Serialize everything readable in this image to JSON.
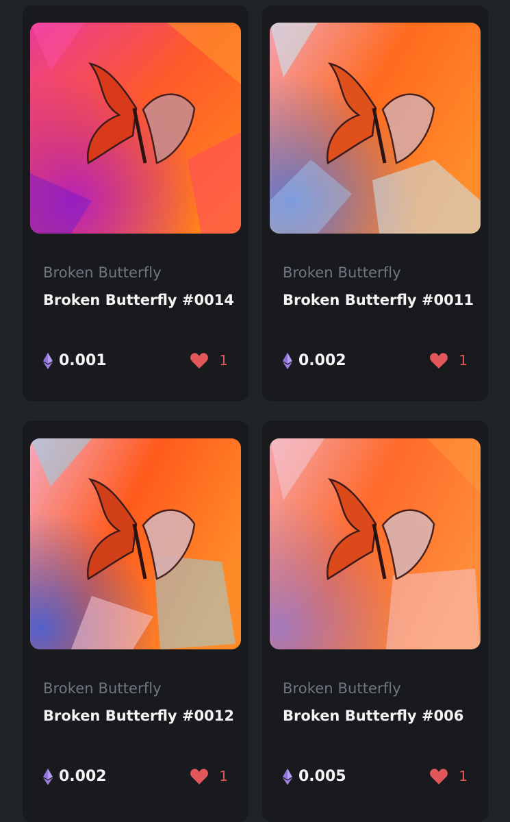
{
  "colors": {
    "page_bg": "#1f2428",
    "card_bg": "#181a1d",
    "collection_text": "#6f7882",
    "title_text": "#f4f4f4",
    "like_red": "#e2585a",
    "eth_purple": "#9b7de0"
  },
  "cards": [
    {
      "collection": "Broken Butterfly",
      "title": "Broken Butterfly #0014",
      "price": "0.001",
      "likes": "1",
      "currency_icon": "ethereum-icon",
      "like_icon": "heart-icon",
      "image_palette": [
        "#e83a9a",
        "#ff5a2a",
        "#b11ec0",
        "#ff8a1a",
        "#ff3f6e"
      ]
    },
    {
      "collection": "Broken Butterfly",
      "title": "Broken Butterfly #0011",
      "price": "0.002",
      "likes": "1",
      "currency_icon": "ethereum-icon",
      "like_icon": "heart-icon",
      "image_palette": [
        "#f2a3b5",
        "#ff6a1e",
        "#5a7ad8",
        "#ff8c2a",
        "#c9e6f2"
      ]
    },
    {
      "collection": "Broken Butterfly",
      "title": "Broken Butterfly #0012",
      "price": "0.002",
      "likes": "1",
      "currency_icon": "ethereum-icon",
      "like_icon": "heart-icon",
      "image_palette": [
        "#f4a9c0",
        "#ff5a1c",
        "#4a5fd0",
        "#ff8a28",
        "#8fd6ec"
      ]
    },
    {
      "collection": "Broken Butterfly",
      "title": "Broken Butterfly #006",
      "price": "0.005",
      "likes": "1",
      "currency_icon": "ethereum-icon",
      "like_icon": "heart-icon",
      "image_palette": [
        "#f2a7b0",
        "#ff6a2a",
        "#9a7ac8",
        "#ff8c3a",
        "#f5c9d4"
      ]
    }
  ]
}
